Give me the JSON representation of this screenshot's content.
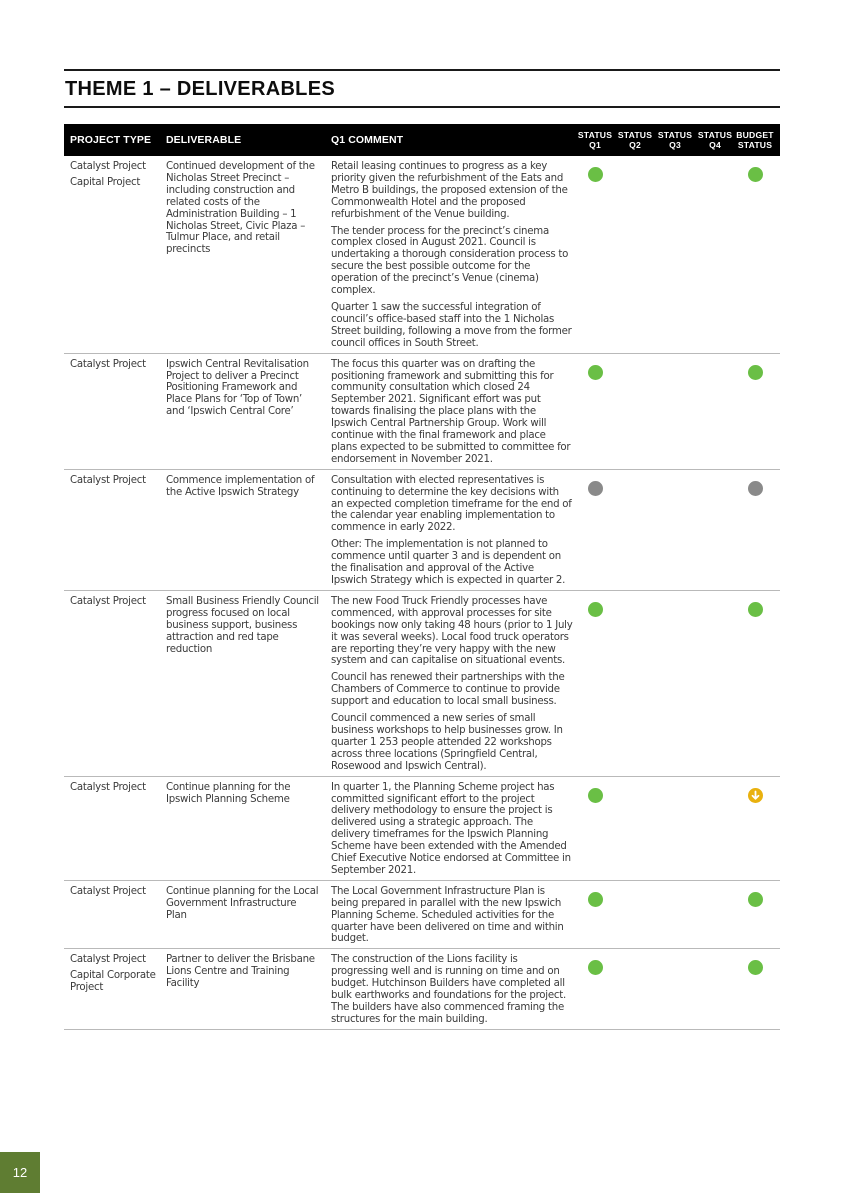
{
  "page": {
    "title": "THEME 1 – DELIVERABLES",
    "page_number": "12",
    "status_colors": {
      "on_track": "#6abf45",
      "not_started": "#8a8a8a",
      "at_risk": "#e9b10e"
    }
  },
  "table": {
    "headers": {
      "project_type": "PROJECT TYPE",
      "deliverable": "DELIVERABLE",
      "q1_comment": "Q1 COMMENT",
      "status_q1": [
        "STATUS",
        "Q1"
      ],
      "status_q2": [
        "STATUS",
        "Q2"
      ],
      "status_q3": [
        "STATUS",
        "Q3"
      ],
      "status_q4": [
        "STATUS",
        "Q4"
      ],
      "budget_status": [
        "BUDGET",
        "STATUS"
      ]
    },
    "rows": [
      {
        "project_type": [
          "Catalyst Project",
          "Capital Project"
        ],
        "deliverable": "Continued development of the Nicholas Street Precinct – including construction and related costs of the Administration Building – 1 Nicholas Street, Civic Plaza – Tulmur Place, and retail precincts",
        "comment": [
          "Retail leasing continues to progress as a key priority given the refurbishment of the Eats and Metro B buildings, the proposed extension of the Commonwealth Hotel and the proposed refurbishment of the Venue building.",
          "The tender process for the precinct’s cinema complex closed in August 2021. Council is undertaking a thorough consideration process to secure the best possible outcome for the operation of the precinct’s Venue (cinema) complex.",
          "Quarter 1 saw the successful integration of council’s office-based staff into the 1 Nicholas Street building, following a move from the former council offices in South Street."
        ],
        "status_q1": "green",
        "status_q2": "",
        "status_q3": "",
        "status_q4": "",
        "budget_status": "green"
      },
      {
        "project_type": [
          "Catalyst Project"
        ],
        "deliverable": "Ipswich Central Revitalisation Project to deliver a Precinct Positioning Framework and Place Plans for ‘Top of Town’ and ‘Ipswich Central Core’",
        "comment": [
          "The focus this quarter was on drafting the positioning framework and submitting this for community consultation which closed 24 September 2021. Significant effort was put towards finalising the place plans with the Ipswich Central Partnership Group. Work will continue with the final framework and place plans expected to be submitted to committee for endorsement in November 2021."
        ],
        "status_q1": "green",
        "status_q2": "",
        "status_q3": "",
        "status_q4": "",
        "budget_status": "green"
      },
      {
        "project_type": [
          "Catalyst Project"
        ],
        "deliverable": "Commence implementation of the Active Ipswich Strategy",
        "comment": [
          "Consultation with elected representatives is continuing to determine the key decisions with an expected completion timeframe for the end of the calendar year enabling implementation to commence in early 2022.",
          "Other: The implementation is not planned to commence until quarter 3 and is dependent on the finalisation and approval of the Active Ipswich Strategy which is expected in quarter 2."
        ],
        "status_q1": "grey",
        "status_q2": "",
        "status_q3": "",
        "status_q4": "",
        "budget_status": "grey"
      },
      {
        "project_type": [
          "Catalyst Project"
        ],
        "deliverable": "Small Business Friendly Council progress focused on local business support, business attraction and red tape reduction",
        "comment": [
          "The new Food Truck Friendly processes have commenced, with approval processes for site bookings now only taking 48 hours (prior to 1 July it was several weeks). Local food truck operators are reporting they’re very happy with the new system and can capitalise on situational events.",
          "Council has renewed their partnerships with the Chambers of Commerce to continue to provide support and education to local small business.",
          "Council commenced a new series of small business workshops to help businesses grow. In quarter 1 253 people attended 22 workshops across three locations (Springfield Central, Rosewood and Ipswich Central)."
        ],
        "status_q1": "green",
        "status_q2": "",
        "status_q3": "",
        "status_q4": "",
        "budget_status": "green"
      },
      {
        "project_type": [
          "Catalyst Project"
        ],
        "deliverable": "Continue planning for the Ipswich Planning Scheme",
        "comment": [
          "In quarter 1, the Planning Scheme project has committed significant effort to the project delivery methodology to ensure the project is delivered using a strategic approach. The delivery timeframes for the Ipswich Planning Scheme have been extended with the Amended Chief Executive Notice endorsed at Committee in September 2021."
        ],
        "status_q1": "green",
        "status_q2": "",
        "status_q3": "",
        "status_q4": "",
        "budget_status": "amber-down"
      },
      {
        "project_type": [
          "Catalyst Project"
        ],
        "deliverable": "Continue planning for the Local Government Infrastructure Plan",
        "comment": [
          "The Local Government Infrastructure Plan is being prepared in parallel with the new Ipswich Planning Scheme. Scheduled activities for the quarter have been delivered on time and within budget."
        ],
        "status_q1": "green",
        "status_q2": "",
        "status_q3": "",
        "status_q4": "",
        "budget_status": "green"
      },
      {
        "project_type": [
          "Catalyst Project",
          "Capital Corporate Project"
        ],
        "deliverable": "Partner to deliver the Brisbane Lions Centre and Training Facility",
        "comment": [
          "The construction of the Lions facility is progressing well and is running on time and on budget. Hutchinson Builders have completed all bulk earthworks and foundations for the project. The builders have also commenced framing the structures for the main building."
        ],
        "status_q1": "green",
        "status_q2": "",
        "status_q3": "",
        "status_q4": "",
        "budget_status": "green"
      }
    ]
  }
}
